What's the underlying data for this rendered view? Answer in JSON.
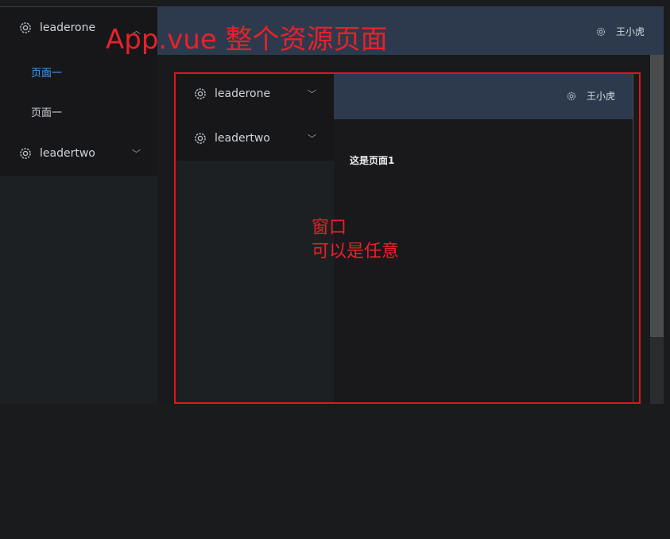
{
  "outer": {
    "sidebar": {
      "menus": [
        {
          "label": "leaderone",
          "icon": "gear-icon",
          "expanded": true,
          "items": [
            {
              "label": "页面一",
              "active": true
            },
            {
              "label": "页面一",
              "active": false
            }
          ]
        },
        {
          "label": "leadertwo",
          "icon": "gear-icon",
          "expanded": false
        }
      ]
    },
    "header": {
      "user": "王小虎",
      "icon": "gear-icon"
    }
  },
  "inner": {
    "sidebar": {
      "menus": [
        {
          "label": "leaderone",
          "icon": "gear-icon",
          "expanded": false
        },
        {
          "label": "leadertwo",
          "icon": "gear-icon",
          "expanded": false
        }
      ]
    },
    "header": {
      "user": "王小虎",
      "icon": "gear-icon"
    },
    "content": {
      "text": "这是页面1"
    }
  },
  "annotations": {
    "title": "App.vue 整个资源页面",
    "window_line1": "窗口",
    "window_line2": "可以是任意"
  },
  "colors": {
    "accent": "#409eff",
    "header": "#2d3a4d",
    "sidebar": "#171719",
    "annotation": "#e6222a"
  }
}
